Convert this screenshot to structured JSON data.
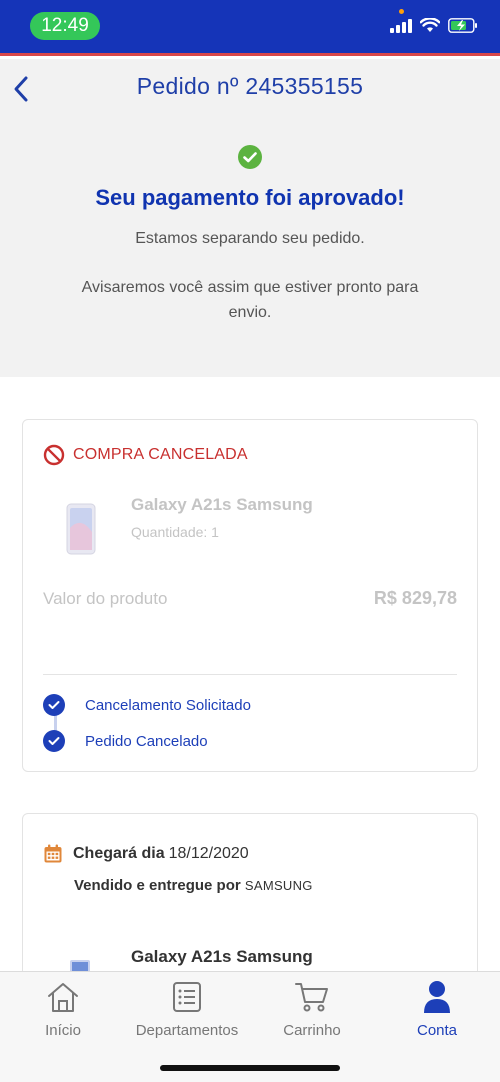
{
  "status_bar": {
    "time": "12:49"
  },
  "header": {
    "title": "Pedido nº 245355155"
  },
  "approval": {
    "title": "Seu pagamento foi aprovado!",
    "subtitle": "Estamos separando seu pedido.",
    "note": "Avisaremos você assim que estiver pronto para envio."
  },
  "cancel_card": {
    "status": "COMPRA CANCELADA",
    "product_name": "Galaxy A21s Samsung",
    "quantity": "Quantidade: 1",
    "price_label": "Valor do produto",
    "price_value": "R$ 829,78",
    "steps": [
      {
        "label": "Cancelamento Solicitado"
      },
      {
        "label": "Pedido Cancelado"
      }
    ]
  },
  "delivery_card": {
    "arrival_label": "Chegará dia",
    "arrival_date": "18/12/2020",
    "sold_label": "Vendido e entregue por",
    "seller": "SAMSUNG",
    "product_name": "Galaxy A21s Samsung"
  },
  "bottom_nav": {
    "items": [
      {
        "label": "Início",
        "icon": "home-icon"
      },
      {
        "label": "Departamentos",
        "icon": "list-icon"
      },
      {
        "label": "Carrinho",
        "icon": "cart-icon"
      },
      {
        "label": "Conta",
        "icon": "user-icon",
        "active": true
      }
    ]
  },
  "colors": {
    "brand_blue": "#1534b8",
    "success_green": "#5cb340",
    "cancel_red": "#c8302f",
    "calendar_orange": "#e0873a"
  }
}
